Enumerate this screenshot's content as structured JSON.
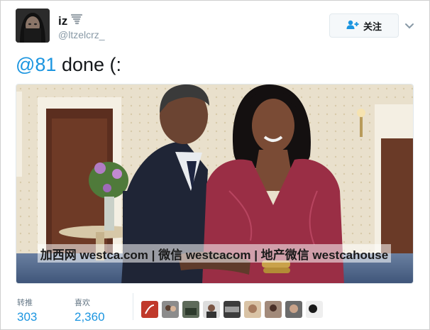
{
  "user": {
    "name": "iz",
    "handle": "@ltzelcrz_"
  },
  "follow_button": {
    "label": "关注"
  },
  "tweet": {
    "mention": "@81",
    "text": " done (:"
  },
  "photo": {
    "watermark": "加西网 westca.com | 微信 westcacom | 地产微信 westcahouse"
  },
  "stats": {
    "retweets": {
      "label": "转推",
      "value": "303"
    },
    "likes": {
      "label": "喜欢",
      "value": "2,360"
    }
  },
  "colors": {
    "link": "#1b95e0",
    "muted": "#8899a6"
  },
  "icons": {
    "name_badge": "tornado-emoji-icon",
    "follow": "add-user-icon",
    "menu": "chevron-down-icon"
  }
}
